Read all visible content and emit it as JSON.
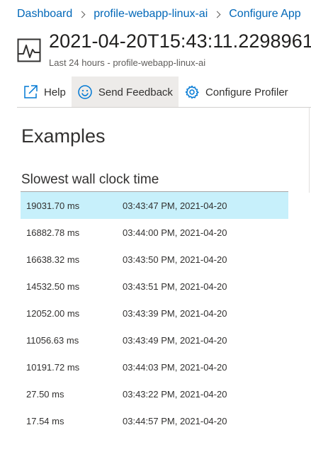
{
  "breadcrumb": {
    "items": [
      "Dashboard",
      "profile-webapp-linux-ai",
      "Configure App"
    ]
  },
  "header": {
    "title": "2021-04-20T15:43:11.2298961",
    "subtitle": "Last 24 hours - profile-webapp-linux-ai",
    "icon": "chart-pulse-icon"
  },
  "toolbar": {
    "help_label": "Help",
    "feedback_label": "Send Feedback",
    "configure_label": "Configure Profiler",
    "icons": [
      "external-link-icon",
      "smiley-icon",
      "gear-icon"
    ]
  },
  "main": {
    "section_title": "Examples",
    "table_title": "Slowest wall clock time",
    "rows": [
      {
        "duration": "19031.70 ms",
        "time": "03:43:47 PM, 2021-04-20",
        "selected": true
      },
      {
        "duration": "16882.78 ms",
        "time": "03:44:00 PM, 2021-04-20"
      },
      {
        "duration": "16638.32 ms",
        "time": "03:43:50 PM, 2021-04-20"
      },
      {
        "duration": "14532.50 ms",
        "time": "03:43:51 PM, 2021-04-20"
      },
      {
        "duration": "12052.00 ms",
        "time": "03:43:39 PM, 2021-04-20"
      },
      {
        "duration": "11056.63 ms",
        "time": "03:43:49 PM, 2021-04-20"
      },
      {
        "duration": "10191.72 ms",
        "time": "03:44:03 PM, 2021-04-20"
      },
      {
        "duration": "27.50 ms",
        "time": "03:43:22 PM, 2021-04-20"
      },
      {
        "duration": "17.54 ms",
        "time": "03:44:57 PM, 2021-04-20"
      }
    ]
  },
  "colors": {
    "link": "#0067b8",
    "selected_row": "#c7f0fb",
    "active_button": "#edebe9",
    "accent_icon": "#0078d4"
  }
}
